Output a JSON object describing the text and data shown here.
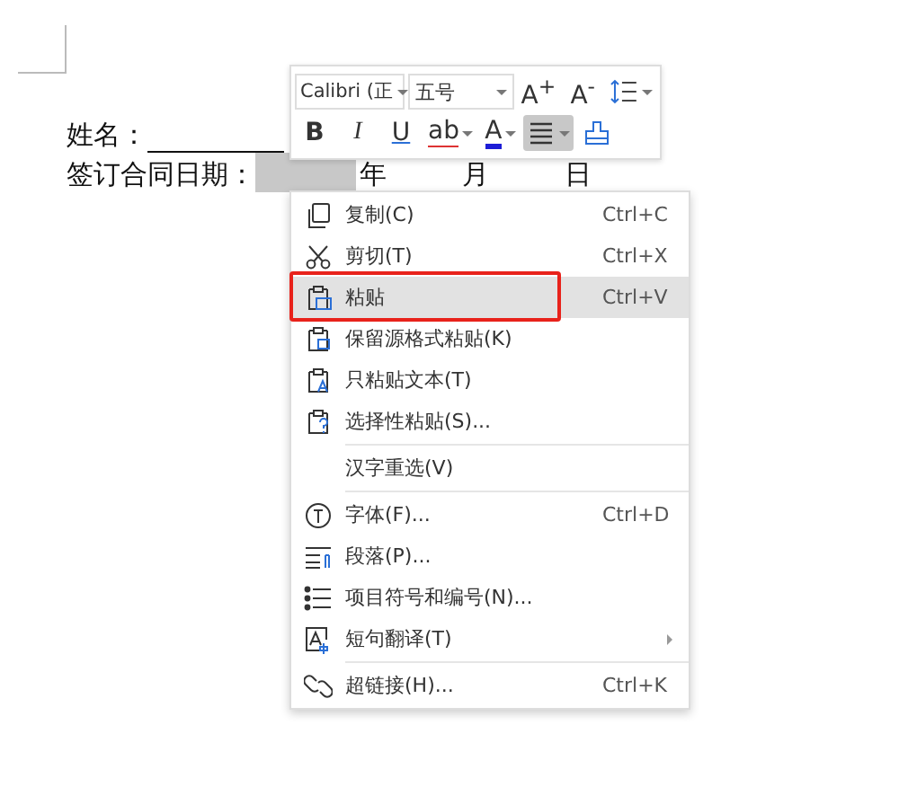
{
  "document": {
    "lines": [
      {
        "label": "姓名：",
        "kind": "underline"
      },
      {
        "label": "签订合同日期：",
        "kind": "date",
        "year": "年",
        "month": "月",
        "day": "日"
      }
    ]
  },
  "toolbar": {
    "font_row": [
      {
        "kind": "field",
        "text": "Calibri (正",
        "dropdown": true
      },
      {
        "kind": "field",
        "text": "五号",
        "dropdown": true
      },
      {
        "kind": "text",
        "text": "A$^{+}$",
        "dropdown": false,
        "selected": false
      },
      {
        "kind": "text",
        "text": "A$^{-}$",
        "dropdown": false,
        "selected": false
      },
      {
        "kind": "icon",
        "dropdown": true,
        "selected": false
      }
    ],
    "format_row": [
      {
        "kind": "text",
        "text": "B",
        "dropdown": false,
        "selected": false
      },
      {
        "kind": "text",
        "text": "I",
        "dropdown": false,
        "selected": false
      },
      {
        "kind": "text",
        "text": "U",
        "dropdown": false,
        "selected": false
      },
      {
        "kind": "text",
        "text": "ab",
        "dropdown": true,
        "selected": false
      },
      {
        "kind": "text",
        "text": "A",
        "dropdown": true,
        "selected": false
      },
      {
        "kind": "icon",
        "dropdown": true,
        "selected": true
      },
      {
        "kind": "icon",
        "dropdown": false,
        "selected": false
      }
    ]
  },
  "context_menu": {
    "groups": [
      [
        {
          "label": "复制(C)",
          "shortcut": "Ctrl+C",
          "selected": false,
          "submenu": false
        },
        {
          "label": "剪切(T)",
          "shortcut": "Ctrl+X",
          "selected": false,
          "submenu": false
        },
        {
          "label": "粘贴",
          "shortcut": "Ctrl+V",
          "selected": true,
          "submenu": false
        },
        {
          "label": "保留源格式粘贴(K)",
          "selected": false,
          "submenu": false
        },
        {
          "label": "只粘贴文本(T)",
          "selected": false,
          "submenu": false
        },
        {
          "label": "选择性粘贴(S)...",
          "selected": false,
          "submenu": false
        }
      ],
      [
        {
          "label": "汉字重选(V)",
          "selected": false,
          "submenu": false
        }
      ],
      [
        {
          "label": "字体(F)...",
          "shortcut": "Ctrl+D",
          "selected": false,
          "submenu": false
        },
        {
          "label": "段落(P)...",
          "selected": false,
          "submenu": false
        },
        {
          "label": "项目符号和编号(N)...",
          "selected": false,
          "submenu": false
        },
        {
          "label": "短句翻译(T)",
          "selected": false,
          "submenu": true
        }
      ],
      [
        {
          "label": "超链接(H)...",
          "shortcut": "Ctrl+K",
          "selected": false,
          "submenu": false
        }
      ]
    ]
  }
}
